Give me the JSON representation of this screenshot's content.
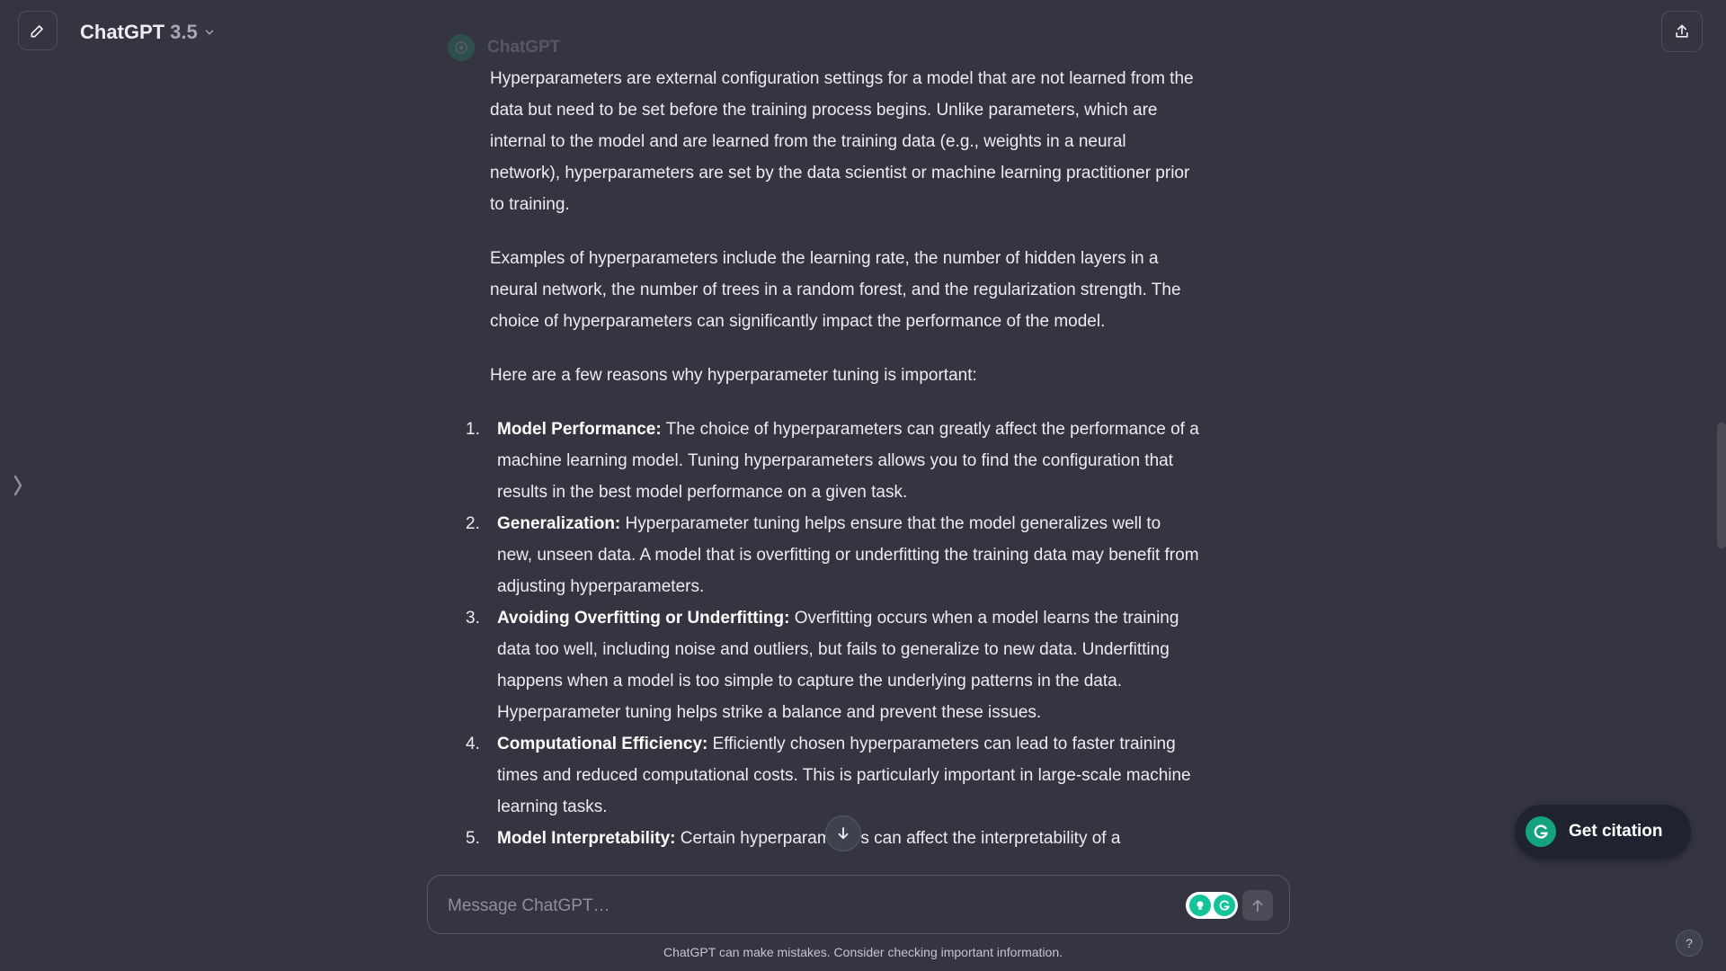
{
  "header": {
    "model_name": "ChatGPT",
    "model_version": "3.5"
  },
  "message": {
    "author": "ChatGPT",
    "paragraphs": [
      "Hyperparameters are external configuration settings for a model that are not learned from the data but need to be set before the training process begins. Unlike parameters, which are internal to the model and are learned from the training data (e.g., weights in a neural network), hyperparameters are set by the data scientist or machine learning practitioner prior to training.",
      "Examples of hyperparameters include the learning rate, the number of hidden layers in a neural network, the number of trees in a random forest, and the regularization strength. The choice of hyperparameters can significantly impact the performance of the model.",
      "Here are a few reasons why hyperparameter tuning is important:"
    ],
    "list": [
      {
        "number": "1.",
        "title": "Model Performance:",
        "text": " The choice of hyperparameters can greatly affect the performance of a machine learning model. Tuning hyperparameters allows you to find the configuration that results in the best model performance on a given task."
      },
      {
        "number": "2.",
        "title": "Generalization:",
        "text": " Hyperparameter tuning helps ensure that the model generalizes well to new, unseen data. A model that is overfitting or underfitting the training data may benefit from adjusting hyperparameters."
      },
      {
        "number": "3.",
        "title": "Avoiding Overfitting or Underfitting:",
        "text": " Overfitting occurs when a model learns the training data too well, including noise and outliers, but fails to generalize to new data. Underfitting happens when a model is too simple to capture the underlying patterns in the data. Hyperparameter tuning helps strike a balance and prevent these issues."
      },
      {
        "number": "4.",
        "title": "Computational Efficiency:",
        "text": " Efficiently chosen hyperparameters can lead to faster training times and reduced computational costs. This is particularly important in large-scale machine learning tasks."
      },
      {
        "number": "5.",
        "title": "Model Interpretability:",
        "text": " Certain hyperparameters can affect the interpretability of a"
      }
    ]
  },
  "composer": {
    "placeholder": "Message ChatGPT…"
  },
  "disclaimer": "ChatGPT can make mistakes. Consider checking important information.",
  "citation": {
    "label": "Get citation",
    "logo_letter": "G"
  },
  "help": "?",
  "icons": {
    "new_chat": "new-chat-pencil-icon",
    "dropdown": "chevron-down-icon",
    "share": "share-upload-icon",
    "sidebar_toggle": "chevron-right-icon",
    "scroll_down": "arrow-down-icon",
    "send": "arrow-up-icon",
    "extension": "grammarly-icon"
  },
  "colors": {
    "background": "#343541",
    "accent_green": "#19c37d",
    "grammarly": "#15a37f"
  }
}
